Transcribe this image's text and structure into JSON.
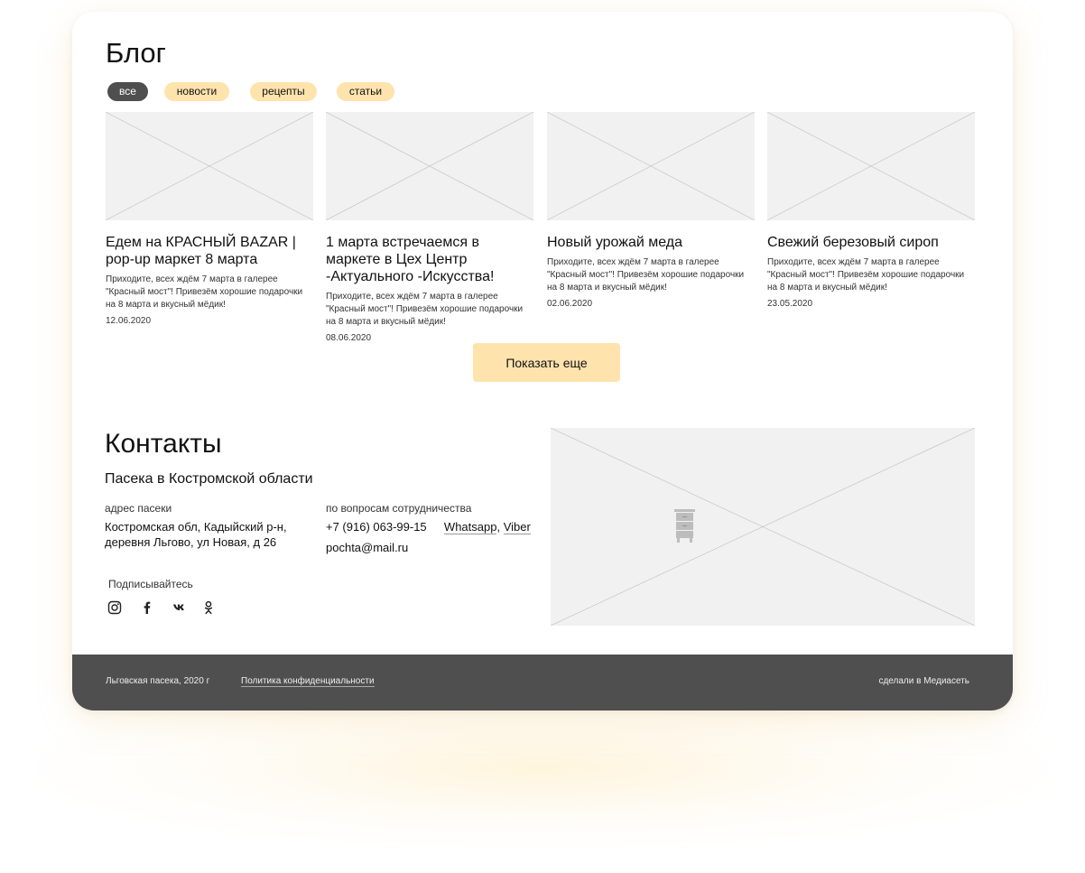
{
  "blog": {
    "title": "Блог",
    "filters": [
      "все",
      "новости",
      "рецепты",
      "статьи"
    ],
    "active_filter": "все",
    "posts": [
      {
        "title": "Едем на КРАСНЫЙ BAZAR | pop-up маркет 8 марта",
        "text": "Приходите, всех ждём 7 марта в галерее \"Красный мост\"! Привезём хорошие подарочки на 8 марта и вкусный мёдик!",
        "date": "12.06.2020"
      },
      {
        "title": "1 марта встречаемся в маркете в Цех Центр -Актуального -Искусства!",
        "text": "Приходите, всех ждём 7 марта в галерее \"Красный мост\"! Привезём хорошие подарочки на 8 марта и вкусный мёдик!",
        "date": "08.06.2020"
      },
      {
        "title": "Новый урожай меда",
        "text": "Приходите, всех ждём 7 марта в галерее \"Красный мост\"! Привезём хорошие подарочки на 8 марта и вкусный мёдик!",
        "date": "02.06.2020"
      },
      {
        "title": "Свежий березовый сироп",
        "text": "Приходите, всех ждём 7 марта в галерее \"Красный мост\"! Привезём хорошие подарочки на 8 марта и вкусный мёдик!",
        "date": "23.05.2020"
      }
    ],
    "more_button": "Показать еще"
  },
  "contacts": {
    "title": "Контакты",
    "subtitle": "Пасека в Костромской области",
    "address_label": "адрес пасеки",
    "address_line1": "Костромская обл, Кадыйский р-н,",
    "address_line2": "деревня Льгово, ул Новая, д 26",
    "coop_label": "по вопросам сотрудничества",
    "phone": "+7 (916) 063-99-15",
    "whatsapp": "Whatsapp",
    "separator": ",",
    "viber": "Viber",
    "email": "pochta@mail.ru",
    "subscribe_label": "Подписывайтесь",
    "social_icons": [
      "instagram-icon",
      "facebook-icon",
      "vk-icon",
      "odnoklassniki-icon"
    ]
  },
  "footer": {
    "copyright": "Льговская пасека, 2020 г",
    "privacy": "Политика конфиденциальности",
    "credit": "сделали в Медиасеть"
  },
  "colors": {
    "accent": "#ffe3ad",
    "active_chip": "#4f4f4f",
    "footer_bg": "#4f4f4f",
    "placeholder": "#f1f1f1"
  }
}
